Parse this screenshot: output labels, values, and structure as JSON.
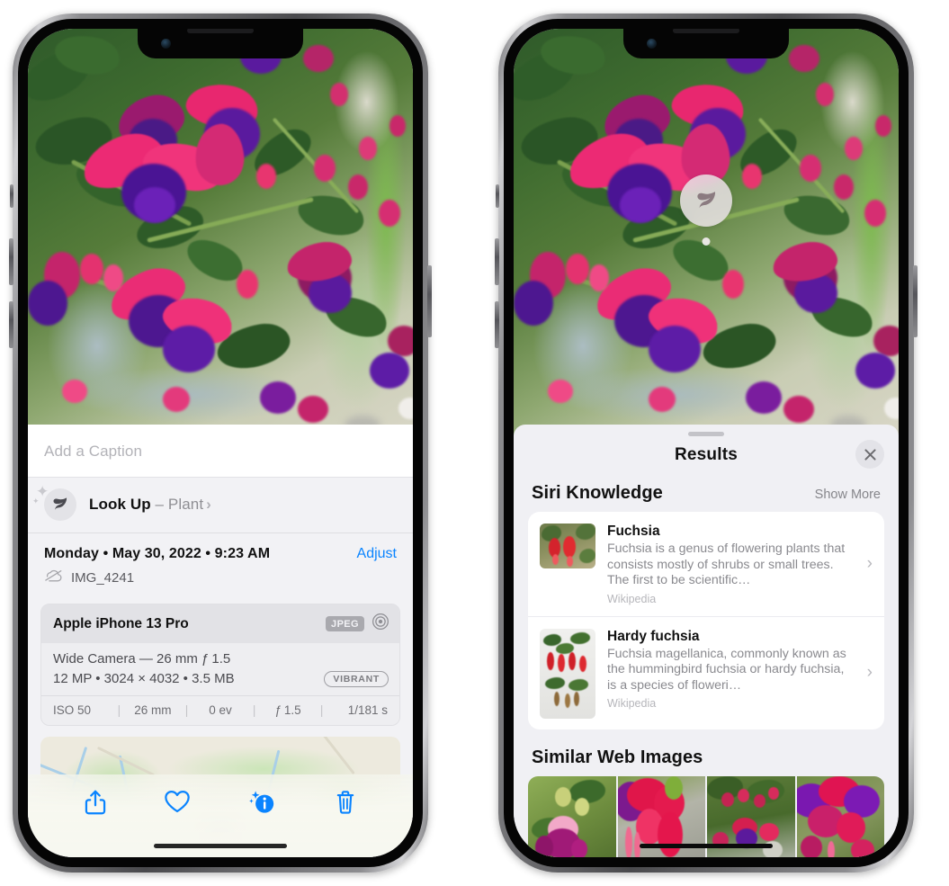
{
  "left_phone": {
    "name": "photo-detail-screen",
    "caption_field": {
      "placeholder": "Add a Caption",
      "value": ""
    },
    "lookup_row": {
      "icon": "leaf-icon",
      "label": "Look Up",
      "dash": " – ",
      "subject": "Plant",
      "chevron": "›"
    },
    "meta": {
      "date_line": "Monday • May 30, 2022 • 9:23 AM",
      "adjust_label": "Adjust",
      "cloud_icon": "cloud-slash-icon",
      "filename": "IMG_4241"
    },
    "exif": {
      "device": "Apple iPhone 13 Pro",
      "format_badge": "JPEG",
      "hdr_icon": "aperture-icon",
      "lens_line": "Wide Camera — 26 mm ƒ 1.5",
      "size_line": "12 MP • 3024 × 4032 • 3.5 MB",
      "vibrant_badge": "VIBRANT",
      "stats": [
        "ISO 50",
        "26 mm",
        "0 ev",
        "ƒ 1.5",
        "1/181 s"
      ],
      "separator": "|"
    },
    "map": {
      "name": "location-map",
      "pin": "photo-thumbnail-pin"
    },
    "toolbar": [
      {
        "name": "share-button",
        "icon": "share-icon"
      },
      {
        "name": "favorite-button",
        "icon": "heart-icon"
      },
      {
        "name": "info-button",
        "icon": "info-sparkle-icon"
      },
      {
        "name": "delete-button",
        "icon": "trash-icon"
      }
    ],
    "accent_color": "#0a84ff"
  },
  "right_phone": {
    "name": "visual-lookup-results-screen",
    "badge": {
      "name": "visual-lookup-badge",
      "icon": "leaf-icon"
    },
    "sheet": {
      "title": "Results",
      "close_icon": "close-icon",
      "grabber": "sheet-grabber"
    },
    "siri_knowledge": {
      "title": "Siri Knowledge",
      "action": "Show More",
      "items": [
        {
          "name": "Fuchsia",
          "description": "Fuchsia is a genus of flowering plants that consists mostly of shrubs or small trees. The first to be scientific…",
          "source": "Wikipedia",
          "chevron": "›"
        },
        {
          "name": "Hardy fuchsia",
          "description": "Fuchsia magellanica, commonly known as the hummingbird fuchsia or hardy fuchsia, is a species of floweri…",
          "source": "Wikipedia",
          "chevron": "›"
        }
      ]
    },
    "similar_web_images": {
      "title": "Similar Web Images",
      "count": 4
    }
  },
  "colors": {
    "accent": "#0a84ff",
    "sheet_bg": "#f0f0f4",
    "card_bg": "#ffffff",
    "secondary_text": "#8a8a8f",
    "badge_grey": "#a9a9ae"
  }
}
